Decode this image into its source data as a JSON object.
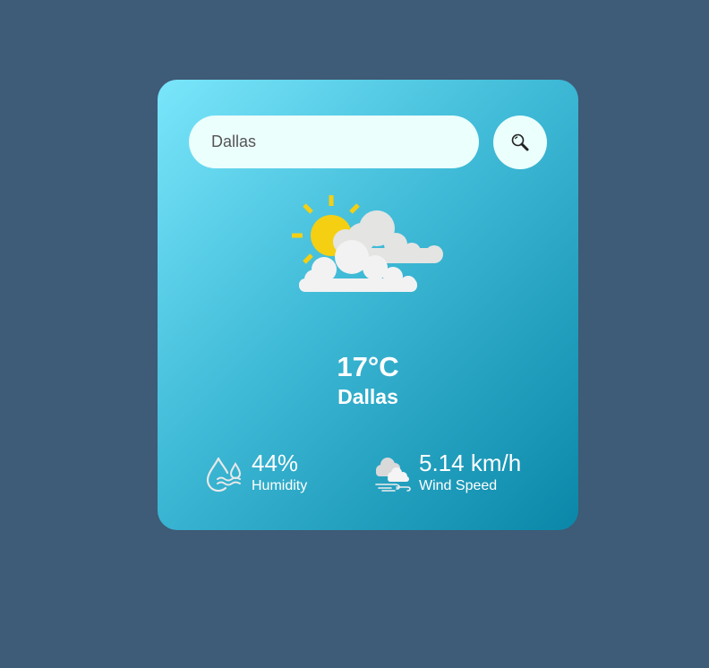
{
  "search": {
    "value": "Dallas",
    "placeholder": "Dallas"
  },
  "weather": {
    "condition_icon": "partly-cloudy-icon",
    "temperature": "17°C",
    "city": "Dallas"
  },
  "details": {
    "humidity": {
      "icon": "humidity-icon",
      "value": "44%",
      "label": "Humidity"
    },
    "wind": {
      "icon": "wind-icon",
      "value": "5.14 km/h",
      "label": "Wind Speed"
    }
  },
  "colors": {
    "page_background": "#3e5b77",
    "card_gradient_start": "#7ae6fb",
    "card_gradient_end": "#0a87a8",
    "input_background": "#ebfffc",
    "sun": "#f5cf12"
  }
}
